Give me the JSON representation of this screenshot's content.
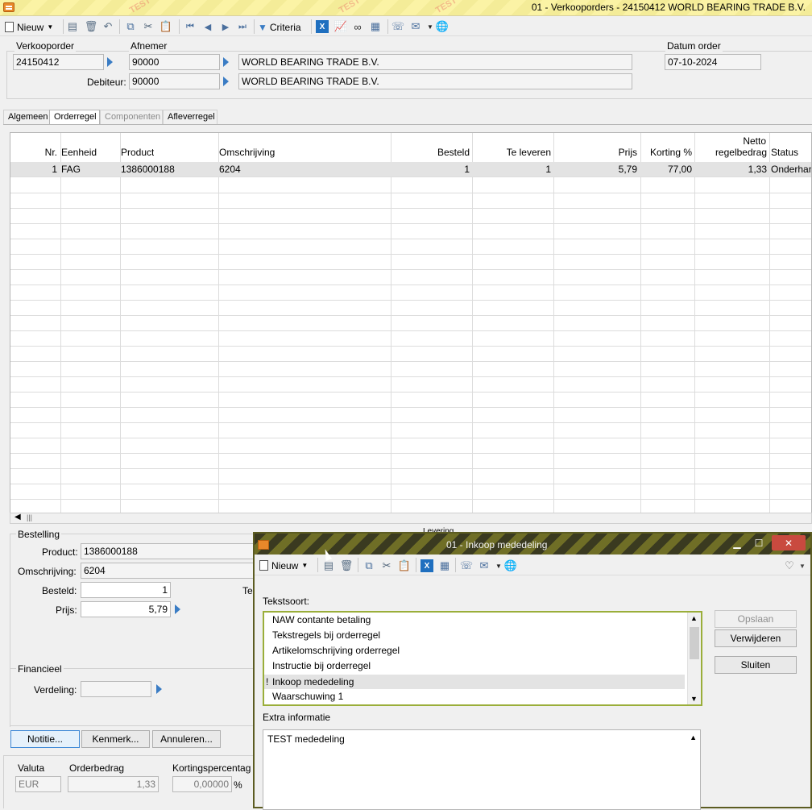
{
  "window": {
    "title": "01 - Verkooporders - 24150412 WORLD BEARING TRADE B.V.",
    "watermark": "TEST"
  },
  "toolbar": {
    "new_label": "Nieuw",
    "criteria_label": "Criteria",
    "icons": [
      "save-icon",
      "delete-icon",
      "undo-icon",
      "copy-icon",
      "cut-icon",
      "paste-icon",
      "first-icon",
      "prev-icon",
      "next-icon",
      "last-icon",
      "filter-icon",
      "excel-icon",
      "chart-icon",
      "binoculars-icon",
      "table-icon",
      "phone-icon",
      "mail-icon",
      "globe-icon"
    ]
  },
  "header": {
    "verkooporder_label": "Verkooporder",
    "verkooporder_value": "24150412",
    "afnemer_label": "Afnemer",
    "afnemer_code": "90000",
    "afnemer_name": "WORLD BEARING TRADE B.V.",
    "debiteur_label": "Debiteur:",
    "debiteur_code": "90000",
    "debiteur_name": "WORLD BEARING TRADE B.V.",
    "datum_label": "Datum order",
    "datum_value": "07-10-2024"
  },
  "tabs": [
    {
      "label": "Algemeen",
      "state": "normal"
    },
    {
      "label": "Orderregel",
      "state": "active"
    },
    {
      "label": "Componenten",
      "state": "disabled"
    },
    {
      "label": "Afleverregel",
      "state": "normal"
    }
  ],
  "grid": {
    "columns": {
      "nr": "Nr.",
      "eenheid": "Eenheid",
      "product": "Product",
      "omschrijving": "Omschrijving",
      "besteld": "Besteld",
      "te_leveren": "Te leveren",
      "prijs": "Prijs",
      "korting": "Korting %",
      "netto_1": "Netto",
      "netto_2": "regelbedrag",
      "status": "Status"
    },
    "rows": [
      {
        "nr": "1",
        "eenheid": "FAG",
        "product": "1386000188",
        "omschrijving": "6204",
        "besteld": "1",
        "te_leveren": "1",
        "prijs": "5,79",
        "korting": "77,00",
        "netto": "1,33",
        "status": "Onderhan"
      }
    ],
    "scroll_glyph": "|||"
  },
  "bestelling": {
    "group_label": "Bestelling",
    "product_label": "Product:",
    "product_value": "1386000188",
    "omschrijving_label": "Omschrijving:",
    "omschrijving_value": "6204",
    "besteld_label": "Besteld:",
    "besteld_value": "1",
    "prijs_label": "Prijs:",
    "prijs_value": "5,79",
    "te_label": "Te",
    "levering_partial": "Levering"
  },
  "financieel": {
    "group_label": "Financieel",
    "verdeling_label": "Verdeling:",
    "verdeling_value": ""
  },
  "buttons": {
    "notitie": "Notitie...",
    "kenmerk": "Kenmerk...",
    "annuleren": "Annuleren..."
  },
  "footer": {
    "valuta_label": "Valuta",
    "valuta_value": "EUR",
    "orderbedrag_label": "Orderbedrag",
    "orderbedrag_value": "1,33",
    "korting_label": "Kortingspercentag",
    "korting_value": "0,00000",
    "percent": "%"
  },
  "dialog": {
    "title": "01 - Inkoop mededeling",
    "new_label": "Nieuw",
    "tekstsoort_label": "Tekstsoort:",
    "items": [
      {
        "label": "NAW contante betaling",
        "marker": ""
      },
      {
        "label": "Tekstregels bij orderregel",
        "marker": ""
      },
      {
        "label": "Artikelomschrijving orderregel",
        "marker": ""
      },
      {
        "label": "Instructie bij orderregel",
        "marker": ""
      },
      {
        "label": "Inkoop mededeling",
        "marker": "!"
      },
      {
        "label": "Waarschuwing 1",
        "marker": ""
      }
    ],
    "selected_index": 4,
    "extra_label": "Extra informatie",
    "extra_text": "TEST mededeling",
    "opslaan": "Opslaan",
    "verwijderen": "Verwijderen",
    "sluiten": "Sluiten"
  },
  "colors": {
    "accent_arrow": "#3a7cc4",
    "dialog_border": "#9aae3a",
    "close_button": "#c94a3f"
  }
}
